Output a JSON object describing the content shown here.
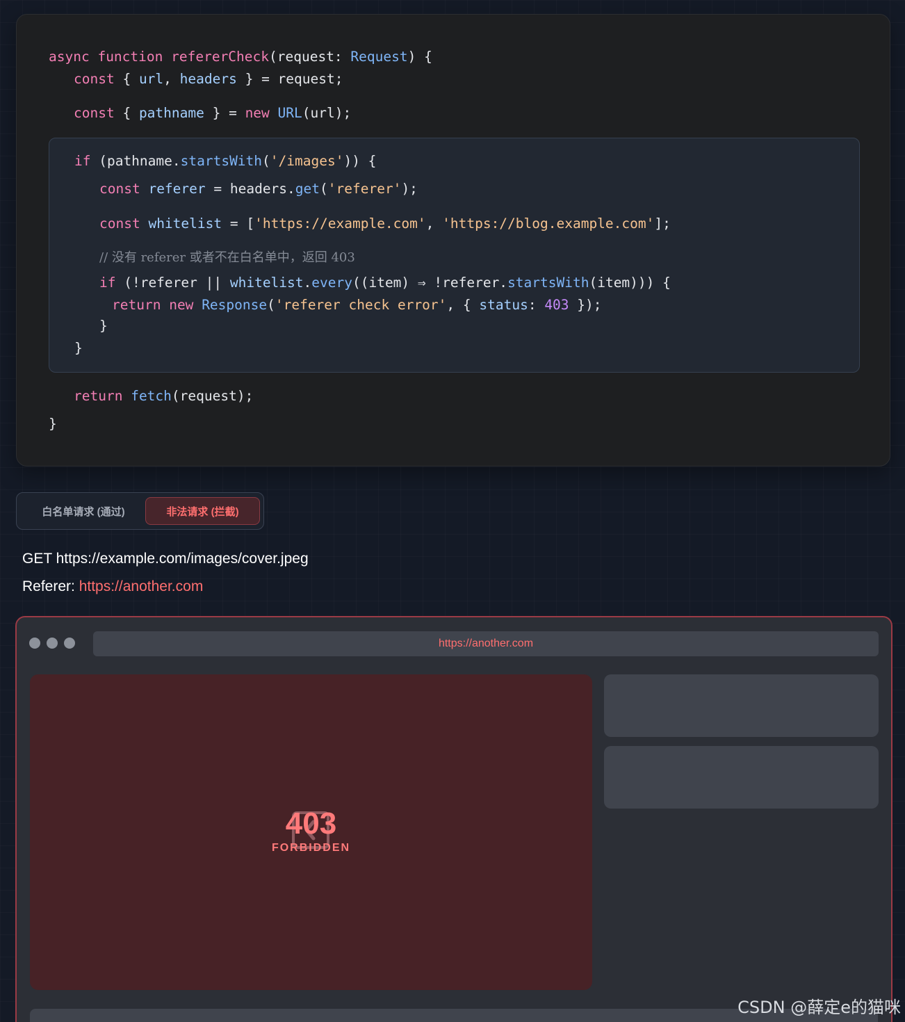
{
  "code": {
    "l1": {
      "kw1": "async",
      "kw2": "function",
      "name": "refererCheck",
      "p1": "(request: ",
      "type": "Request",
      "p2": ") {"
    },
    "l2": {
      "kw": "const",
      "p1": " { ",
      "v1": "url",
      "p2": ", ",
      "v2": "headers",
      "p3": " } = request;"
    },
    "l3": {
      "kw": "const",
      "p1": " { ",
      "v1": "pathname",
      "p2": " } = ",
      "kw2": "new",
      "type": "URL",
      "p3": "(url);"
    },
    "l4": {
      "kw": "if",
      "p1": " (pathname.",
      "call": "startsWith",
      "p2": "(",
      "str": "'/images'",
      "p3": ")) {"
    },
    "l5": {
      "kw": "const",
      "v1": "referer",
      "p1": " = headers.",
      "call": "get",
      "p2": "(",
      "str": "'referer'",
      "p3": ");"
    },
    "l6": {
      "kw": "const",
      "v1": "whitelist",
      "p1": " = [",
      "s1": "'https://example.com'",
      "p2": ", ",
      "s2": "'https://blog.example.com'",
      "p3": "];"
    },
    "l7": {
      "comment": "// 没有 referer 或者不在白名单中，返回 403"
    },
    "l8": {
      "kw": "if",
      "p1": " (!referer ",
      "p2": "|| ",
      "v1": "whitelist",
      "p3": ".",
      "call1": "every",
      "p4": "((item) ",
      "p5": "⇒ ",
      "p6": "!referer.",
      "call2": "startsWith",
      "p7": "(item))) {"
    },
    "l9": {
      "kw": "return",
      "kw2": "new",
      "type": "Response",
      "p1": "(",
      "str": "'referer check error'",
      "p2": ", { ",
      "v1": "status",
      "p3": ": ",
      "num": "403",
      "p4": " });"
    },
    "l10": "}",
    "l11": "}",
    "l12": {
      "kw": "return",
      "call": "fetch",
      "p1": "(request);"
    },
    "l13": "}"
  },
  "toggle": {
    "allow_label": "白名单请求 (通过)",
    "deny_label": "非法请求 (拦截)"
  },
  "request": {
    "line1": "GET https://example.com/images/cover.jpeg",
    "referer_label": "Referer: ",
    "referer_value": "https://another.com"
  },
  "browser": {
    "address": "https://another.com",
    "error_code": "403",
    "error_text": "FORBIDDEN"
  },
  "watermark": "CSDN @薛定e的猫咪",
  "colors": {
    "accent_error": "#ff6f6f",
    "keyword": "#f37fb4",
    "function_call": "#7fb5f7",
    "string": "#f6c390",
    "number": "#c58af9"
  }
}
